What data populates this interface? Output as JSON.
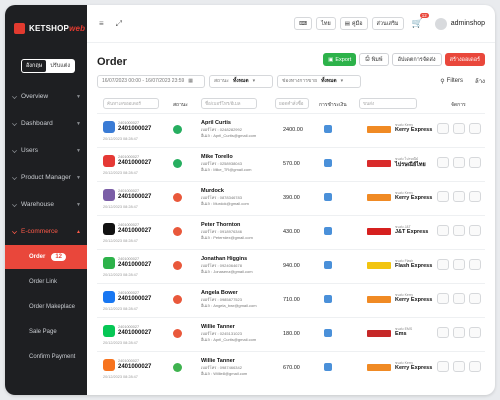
{
  "brand": {
    "name": "KETSHOP",
    "suffix": "web"
  },
  "lang": {
    "th": "อังกฤษ",
    "en": "ปรับแต่ง"
  },
  "nav": [
    {
      "label": "Overview"
    },
    {
      "label": "Dashboard"
    },
    {
      "label": "Users"
    },
    {
      "label": "Product Manager"
    },
    {
      "label": "Warehouse"
    },
    {
      "label": "E-commerce"
    }
  ],
  "subnav": [
    {
      "label": "Order",
      "badge": "12"
    },
    {
      "label": "Order Link"
    },
    {
      "label": "Order Makeplace"
    },
    {
      "label": "Sale Page"
    },
    {
      "label": "Confirm Payment"
    }
  ],
  "topbar": {
    "kb": "⌨",
    "lang": "ไทย",
    "help": "คู่มือ",
    "extra": "ส่วนเสริม",
    "cart_count": "12",
    "username": "adminshop"
  },
  "page": {
    "title": "Order"
  },
  "actions": {
    "export": "Export",
    "print": "พิมพ์",
    "shipping": "อัปเดตการจัดส่ง",
    "create": "สร้างออเดอร์"
  },
  "filters": {
    "date_range": "16/07/2023 00:00 - 16/07/2023 23:59",
    "status_label": "สถานะ",
    "status_value": "ทั้งหมด",
    "channel_label": "ช่องทางการขาย",
    "channel_value": "ทั้งหมด",
    "filters_label": "Filters",
    "more": "ล้าง"
  },
  "table": {
    "headers": {
      "status": "สถานะ",
      "payment": "การชำระเงิน",
      "manage": "จัดการ"
    },
    "search": {
      "order": "ค้นหาเลขออเดอร์",
      "customer": "ชื่อ/เบอร์โทร/อีเมล",
      "amount": "ยอดคำสั่งซื้อ",
      "carrier": "ขนส่ง"
    },
    "rows": [
      {
        "order": "2401000027",
        "small": "2401000027",
        "date": "20/12/2023 08:28:47",
        "name": "April Curtis",
        "phone": "เบอร์โทร : 0248282992",
        "email": "อีเมล : April_Curtis@gmail.com",
        "amount": "2400.00",
        "carrier_label": "ขนส่ง Kerry",
        "carrier": "Kerry Express",
        "channel_color": "#3a7bd5",
        "status_color": "#27ae60",
        "carrier_color": "#f08a24"
      },
      {
        "order": "2401000027",
        "small": "2401000027",
        "date": "20/12/2023 08:28:47",
        "name": "Mike Torello",
        "phone": "เบอร์โทร : 0258938043",
        "email": "อีเมล : Mike_TR@gmail.com",
        "amount": "570.00",
        "carrier_label": "ขนส่ง ไปรษณีย์",
        "carrier": "ไปรษณีย์ไทย",
        "channel_color": "#e53935",
        "status_color": "#27ae60",
        "carrier_color": "#d92b2b"
      },
      {
        "order": "2401000027",
        "small": "2401000027",
        "date": "20/12/2023 08:28:47",
        "name": "Murdock",
        "phone": "เบอร์โทร : 0878346783",
        "email": "อีเมล : Murdok@gmail.com",
        "amount": "390.00",
        "carrier_label": "ขนส่ง Kerry",
        "carrier": "Kerry Express",
        "channel_color": "#7b5ea7",
        "status_color": "#e9583b",
        "carrier_color": "#f08a24"
      },
      {
        "order": "2401000027",
        "small": "2401000027",
        "date": "20/12/2023 08:28:47",
        "name": "Peter Thornton",
        "phone": "เบอร์โทร : 0918976346",
        "email": "อีเมล : Peterrdex@gmail.com",
        "amount": "430.00",
        "carrier_label": "ขนส่ง J&T",
        "carrier": "J&T Express",
        "channel_color": "#111111",
        "status_color": "#e9583b",
        "carrier_color": "#d6201f"
      },
      {
        "order": "2401000027",
        "small": "2401000027",
        "date": "20/12/2023 08:28:47",
        "name": "Jonathan Higgins",
        "phone": "เบอร์โทร : 0924064678",
        "email": "อีเมล : Jonasenz@gmail.com",
        "amount": "940.00",
        "carrier_label": "ขนส่ง Flash",
        "carrier": "Flash Express",
        "channel_color": "#2db24a",
        "status_color": "#e9583b",
        "carrier_color": "#f2c40f"
      },
      {
        "order": "2401000027",
        "small": "2401000027",
        "date": "20/12/2023 08:28:47",
        "name": "Angela Bower",
        "phone": "เบอร์โทร : 0985877523",
        "email": "อีเมล : Angela_bwr@gmail.com",
        "amount": "710.00",
        "carrier_label": "ขนส่ง Kerry",
        "carrier": "Kerry Express",
        "channel_color": "#1877f2",
        "status_color": "#e9583b",
        "carrier_color": "#f08a24"
      },
      {
        "order": "2401000027",
        "small": "2401000027",
        "date": "20/12/2023 08:28:47",
        "name": "Willie Tanner",
        "phone": "เบอร์โทร : 0245131023",
        "email": "อีเมล : April_Curtis@gmail.com",
        "amount": "180.00",
        "carrier_label": "ขนส่ง EMS",
        "carrier": "Ems",
        "channel_color": "#06c755",
        "status_color": "#e9583b",
        "carrier_color": "#c62828"
      },
      {
        "order": "2401000027",
        "small": "2401000027",
        "date": "20/12/2023 08:28:47",
        "name": "Willie Tanner",
        "phone": "เบอร์โทร : 0987466342",
        "email": "อีเมล : Willie8@gmail.com",
        "amount": "670.00",
        "carrier_label": "ขนส่ง Kerry",
        "carrier": "Kerry Express",
        "channel_color": "#f7731e",
        "status_color": "#3fb34f",
        "carrier_color": "#f08a24"
      }
    ]
  }
}
